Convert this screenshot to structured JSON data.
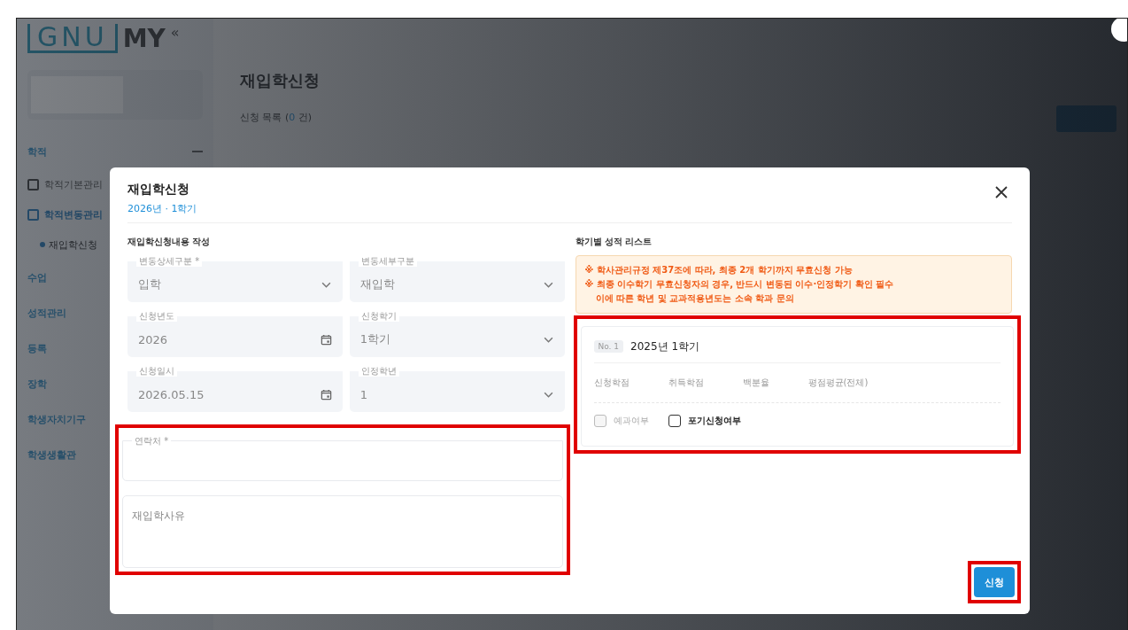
{
  "logo": {
    "mark": "GNU",
    "text": "MY",
    "collapse": "«"
  },
  "sidebar": {
    "items": [
      {
        "label": "학적",
        "expanded": true,
        "children": [
          {
            "label": "학적기본관리",
            "selected": false
          },
          {
            "label": "학적변동관리",
            "selected": true,
            "children": [
              {
                "label": "재입학신청",
                "selected": true
              }
            ]
          }
        ]
      },
      {
        "label": "수업"
      },
      {
        "label": "성적관리"
      },
      {
        "label": "등록"
      },
      {
        "label": "장학"
      },
      {
        "label": "학생자치기구"
      },
      {
        "label": "학생생활관"
      }
    ]
  },
  "page": {
    "title": "재입학신청",
    "list_label": "신청 목록 (",
    "count": "0",
    "count_suffix": " 건)"
  },
  "modal": {
    "title": "재입학신청",
    "subtitle": "2026년 · 1학기",
    "form": {
      "title": "재입학신청내용 작성",
      "fields": [
        {
          "label": "변동상세구분 *",
          "value": "입학",
          "kind": "select"
        },
        {
          "label": "변동세부구분",
          "value": "재입학",
          "kind": "select"
        },
        {
          "label": "신청년도",
          "value": "2026",
          "kind": "date"
        },
        {
          "label": "신청학기",
          "value": "1학기",
          "kind": "select"
        },
        {
          "label": "신청일시",
          "value": "2026.05.15",
          "kind": "date"
        },
        {
          "label": "인정학년",
          "value": "1",
          "kind": "select"
        }
      ],
      "highlighted": true,
      "contact": {
        "label": "연락처 *"
      },
      "reason": {
        "placeholder": "재입학사유"
      }
    },
    "grades": {
      "title": "학기별 성적 리스트",
      "notice": [
        "※ 학사관리규정 제37조에 따라, 최종 2개 학기까지 무효신청 가능",
        "※ 최종 이수학기 무효신청자의 경우, 반드시 변동된 이수·인정학기 확인 필수",
        "이에 따른 학년 및 교과적용년도는 소속 학과 문의"
      ],
      "highlighted": true,
      "card": {
        "badge": "No. 1",
        "title": "2025년 1학기",
        "columns": [
          "신청학점",
          "취득학점",
          "백분율",
          "평점평균(전체)"
        ],
        "checkboxes": [
          {
            "label": "예과여부",
            "checked": false,
            "disabled": true
          },
          {
            "label": "포기신청여부",
            "checked": false,
            "disabled": false
          }
        ]
      }
    },
    "submit": {
      "label": "신청",
      "highlighted": true
    }
  }
}
